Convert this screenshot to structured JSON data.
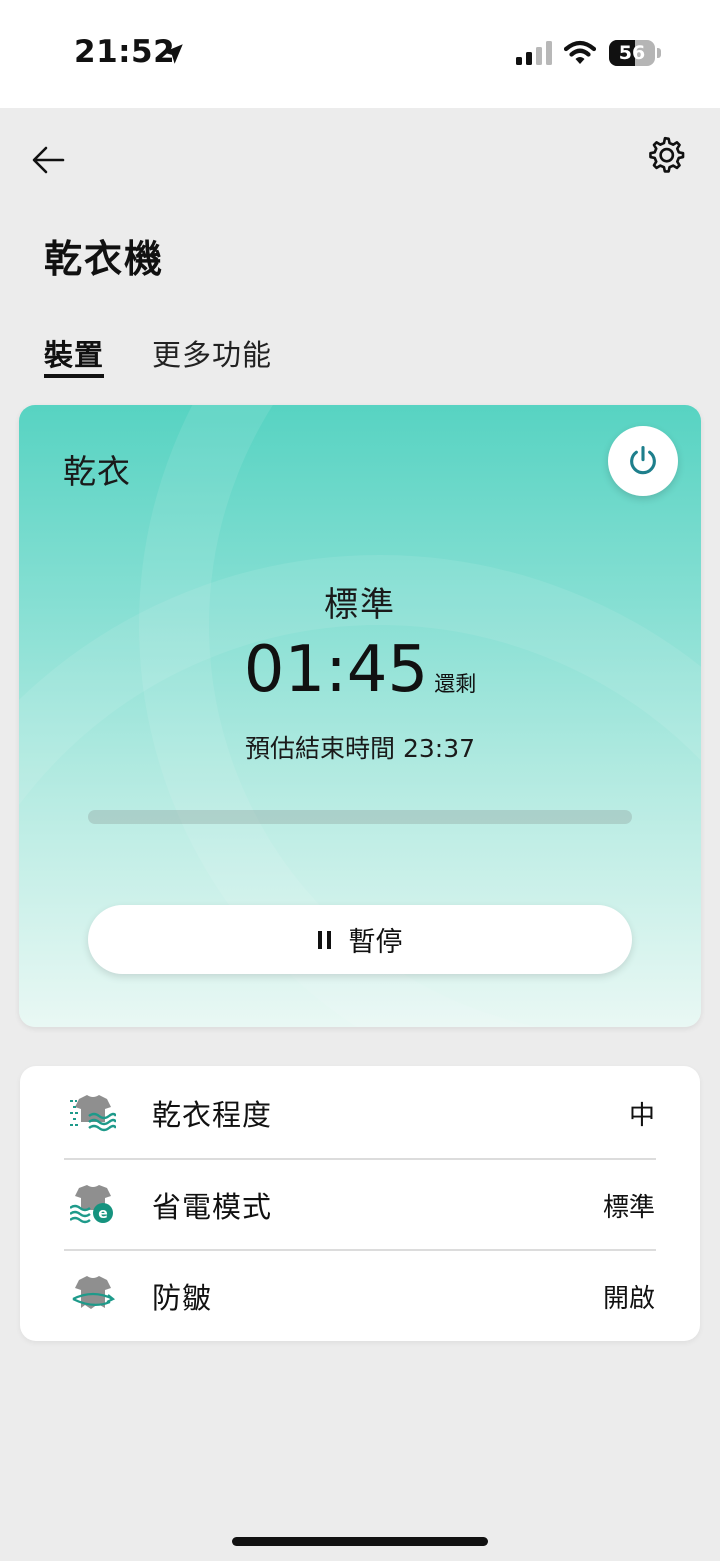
{
  "status_bar": {
    "time": "21:52",
    "battery": "56",
    "battery_level": 0.56
  },
  "header": {
    "title": "乾衣機",
    "back_icon": "arrow-left-icon",
    "settings_icon": "gear-icon"
  },
  "tabs": [
    {
      "label": "裝置",
      "active": true
    },
    {
      "label": "更多功能",
      "active": false
    }
  ],
  "status_card": {
    "mode": "乾衣",
    "course": "標準",
    "time_remaining": "01:45",
    "remaining_label": "還剩",
    "estimated_end_label": "預估結束時間",
    "estimated_end_time": "23:37",
    "progress": 0.0,
    "pause_label": "暫停",
    "colors": {
      "gradient_top": "#57d3c2",
      "gradient_bottom": "#e9f8f4",
      "power_icon": "#1e7f8c"
    }
  },
  "options": [
    {
      "icon": "dry-level-icon",
      "label": "乾衣程度",
      "value": "中"
    },
    {
      "icon": "energy-saving-icon",
      "label": "省電模式",
      "value": "標準"
    },
    {
      "icon": "anti-crease-icon",
      "label": "防皺",
      "value": "開啟"
    }
  ]
}
